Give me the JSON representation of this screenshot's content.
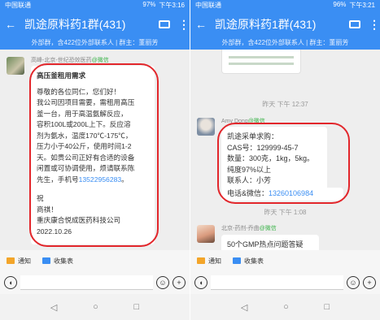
{
  "left": {
    "status": {
      "carrier": "中国联通",
      "right": "97%",
      "time": "下午3:16"
    },
    "title": "凯途原料药1群(431)",
    "subtitle": "外部群，含422位外部联系人 | 群主：董丽芳",
    "message": {
      "sender": "高峰-北京-世纪恐效医药",
      "wx": "@微信",
      "lines": [
        "高压釜租用需求",
        "",
        "尊敬的各位同仁，您们好！",
        "我公司因项目需要，需租用高压",
        "釜一台，用于高温氨解反应，",
        "容积100L或200L上下。反应溶",
        "剂为氨水，温度170℃-175℃，",
        "压力小于40公斤，使用时间1-2",
        "天。如贵公司正好有合适的设备",
        "闲置或可协调使用，烦请联系陈",
        "先生，手机号"
      ],
      "phone": "13522956283",
      "phone_tail": "。",
      "closing": [
        "",
        "祝",
        "商祺！",
        "重庆康合悦成医药科技公司",
        "2022.10.26"
      ]
    },
    "toolbar": {
      "notice": "通知",
      "collect": "收集表"
    }
  },
  "right": {
    "status": {
      "carrier": "中国联通",
      "right": "96%",
      "time": "下午3:21"
    },
    "title": "凯途原料药1群(431)",
    "subtitle": "外部群，含422位外部联系人 | 群主：董丽芳",
    "time1": "昨天 下午 12:37",
    "message1": {
      "sender": "Amy Dong",
      "wx": "@微信",
      "lines": [
        "凯途采单求购：",
        "CAS号：129999-45-7",
        "数量：300克，1kg，5kg。",
        "纯度97%以上",
        "联系人：小芳"
      ],
      "contact_label": "电话&微信：",
      "contact_phone": "13260106984"
    },
    "time2": "昨天 下午 1:08",
    "message2": {
      "sender": "北京-药剂-乔曲",
      "wx": "@微信",
      "text": "50个GMP热点问题答疑"
    },
    "toolbar": {
      "notice": "通知",
      "collect": "收集表"
    }
  },
  "colors": {
    "brand": "#3a8ef3",
    "highlight_ring": "#e2262b",
    "wechat_green": "#3cb34a"
  }
}
